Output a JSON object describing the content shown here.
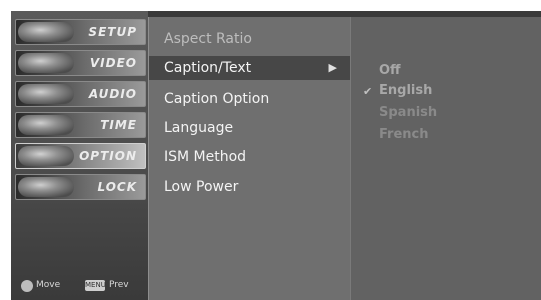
{
  "main_menu": {
    "items": [
      {
        "label": "SETUP",
        "icon": "setup-icon",
        "active": false
      },
      {
        "label": "VIDEO",
        "icon": "video-icon",
        "active": false
      },
      {
        "label": "AUDIO",
        "icon": "audio-icon",
        "active": false
      },
      {
        "label": "TIME",
        "icon": "time-icon",
        "active": false
      },
      {
        "label": "OPTION",
        "icon": "option-icon",
        "active": true
      },
      {
        "label": "LOCK",
        "icon": "lock-icon",
        "active": false
      }
    ]
  },
  "footer": {
    "move_label": "Move",
    "prev_label": "Prev",
    "prev_badge": "MENU"
  },
  "option_menu": {
    "items": [
      {
        "label": "Aspect Ratio",
        "state": "dim"
      },
      {
        "label": "Caption/Text",
        "state": "selected",
        "has_submenu": true,
        "arrow": "▶"
      },
      {
        "label": "Caption Option",
        "state": "normal"
      },
      {
        "label": "Language",
        "state": "normal"
      },
      {
        "label": "ISM Method",
        "state": "normal"
      },
      {
        "label": "Low Power",
        "state": "normal"
      }
    ]
  },
  "caption_submenu": {
    "items": [
      {
        "label": "Off",
        "checked": false
      },
      {
        "label": "English",
        "checked": true
      },
      {
        "label": "Spanish",
        "checked": false
      },
      {
        "label": "French",
        "checked": false
      }
    ],
    "check_mark": "✔"
  }
}
